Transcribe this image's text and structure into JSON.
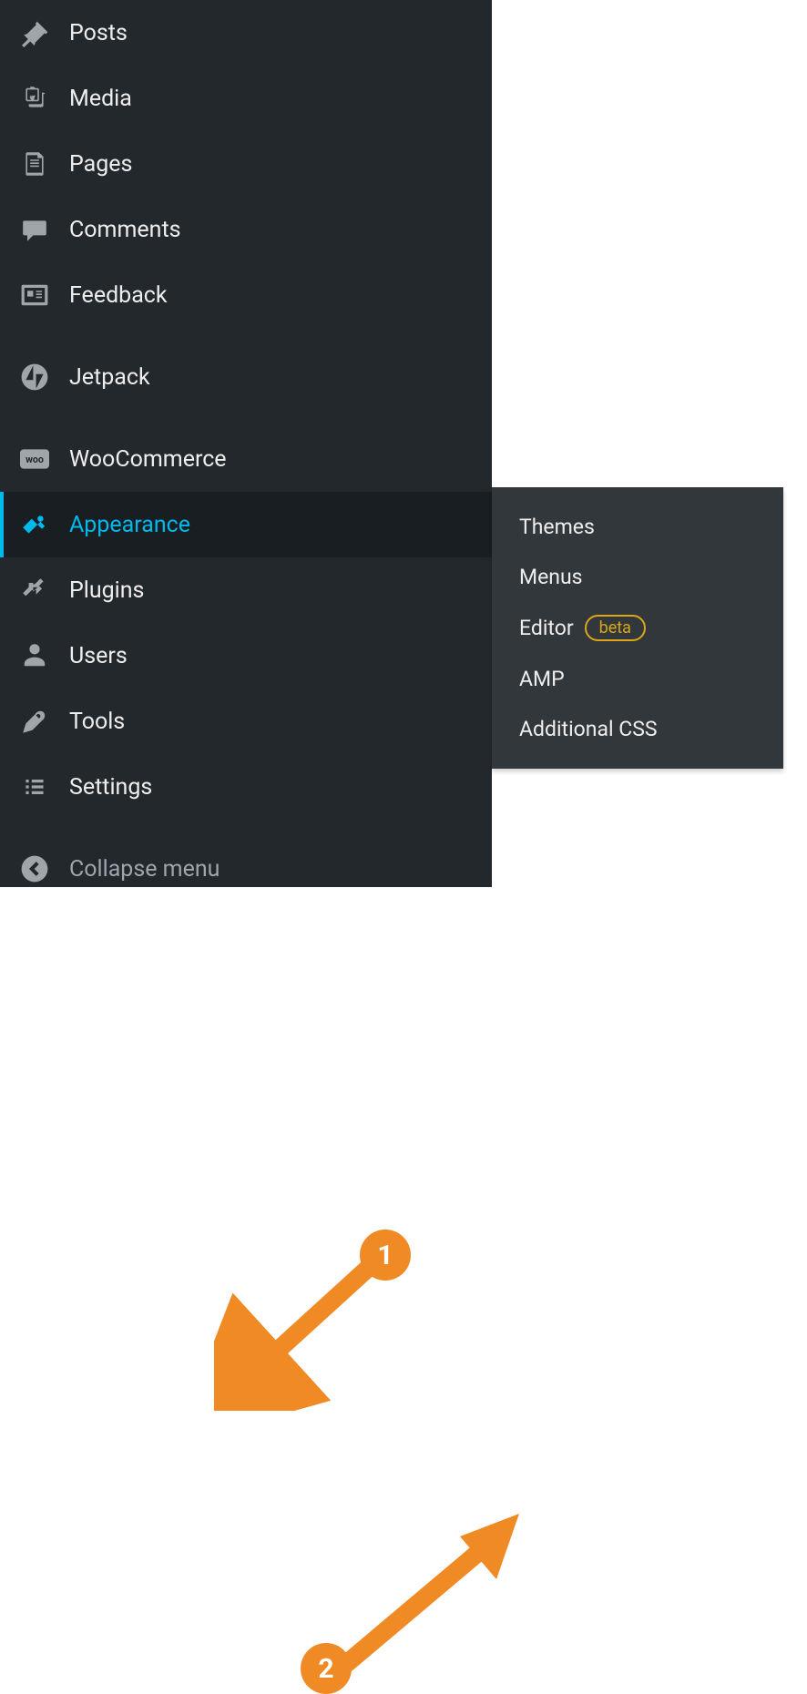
{
  "sidebar": {
    "items": [
      {
        "label": "Posts",
        "icon": "pin-icon"
      },
      {
        "label": "Media",
        "icon": "media-icon"
      },
      {
        "label": "Pages",
        "icon": "pages-icon"
      },
      {
        "label": "Comments",
        "icon": "comments-icon"
      },
      {
        "label": "Feedback",
        "icon": "feedback-icon"
      },
      {
        "label": "Jetpack",
        "icon": "jetpack-icon"
      },
      {
        "label": "WooCommerce",
        "icon": "woocommerce-icon"
      },
      {
        "label": "Appearance",
        "icon": "appearance-icon",
        "active": true
      },
      {
        "label": "Plugins",
        "icon": "plugins-icon"
      },
      {
        "label": "Users",
        "icon": "users-icon"
      },
      {
        "label": "Tools",
        "icon": "tools-icon"
      },
      {
        "label": "Settings",
        "icon": "settings-icon"
      }
    ],
    "collapse_label": "Collapse menu"
  },
  "submenu": {
    "items": [
      {
        "label": "Themes"
      },
      {
        "label": "Menus"
      },
      {
        "label": "Editor",
        "badge": "beta"
      },
      {
        "label": "AMP"
      },
      {
        "label": "Additional CSS"
      }
    ]
  },
  "annotations": {
    "badge1": "1",
    "badge2": "2"
  },
  "colors": {
    "sidebar_bg": "#23282d",
    "active_bg": "#191e23",
    "active_color": "#00b9eb",
    "submenu_bg": "#32373c",
    "annotation_orange": "#f08a24",
    "beta_color": "#dba617"
  }
}
